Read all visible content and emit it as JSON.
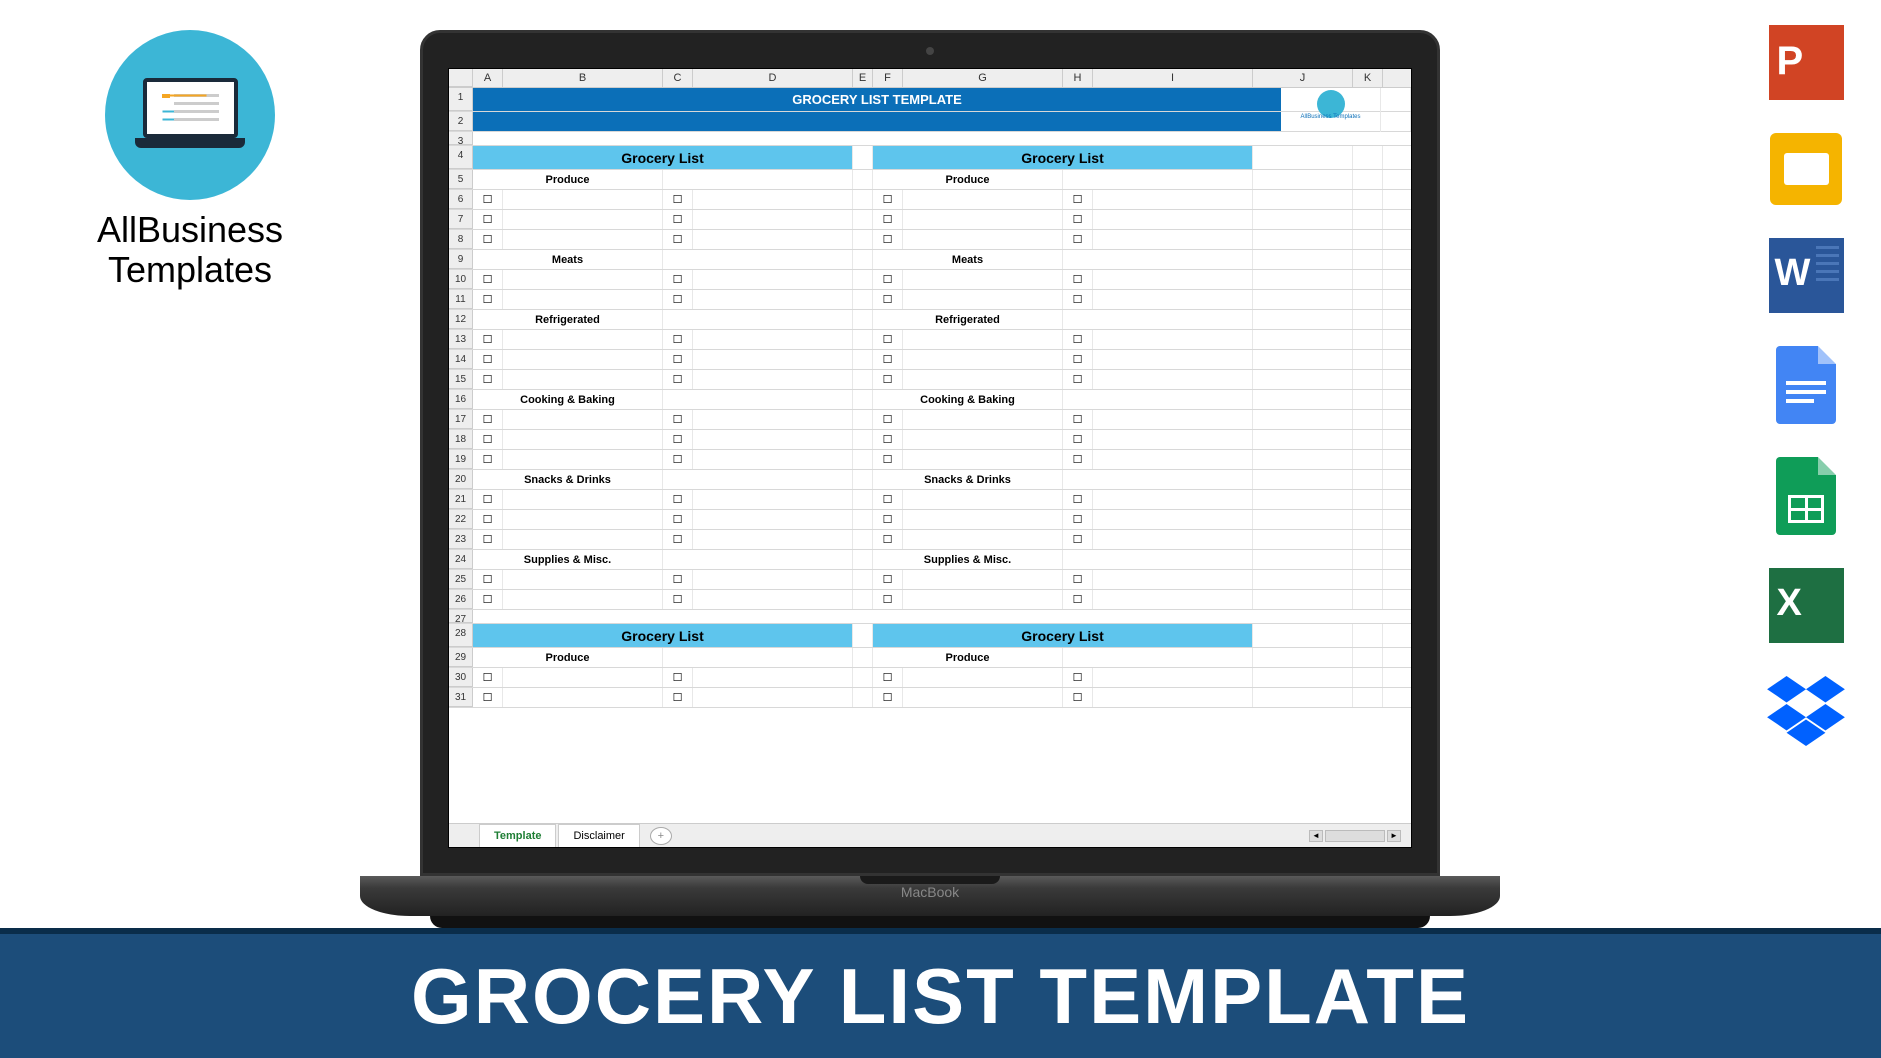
{
  "logo": {
    "line1": "AllBusiness",
    "line2": "Templates"
  },
  "banner": {
    "title": "GROCERY LIST TEMPLATE"
  },
  "icons": {
    "ppt": "PowerPoint",
    "slides": "Google Slides",
    "word": "Word",
    "docs": "Google Docs",
    "sheets": "Google Sheets",
    "excel": "Excel",
    "dropbox": "Dropbox"
  },
  "laptop_brand": "MacBook",
  "spreadsheet": {
    "columns": [
      "",
      "A",
      "B",
      "C",
      "D",
      "E",
      "F",
      "G",
      "H",
      "I",
      "J",
      "K"
    ],
    "row_numbers": [
      1,
      2,
      3,
      4,
      5,
      6,
      7,
      8,
      9,
      10,
      11,
      12,
      13,
      14,
      15,
      16,
      17,
      18,
      19,
      20,
      21,
      22,
      23,
      24,
      25,
      26,
      27,
      28,
      29,
      30,
      31
    ],
    "title": "GROCERY LIST TEMPLATE",
    "logo_badge": "AllBusiness Templates",
    "list_header": "Grocery List",
    "checkbox": "☐",
    "categories": {
      "produce": "Produce",
      "meats": "Meats",
      "refrigerated": "Refrigerated",
      "cooking": "Cooking & Baking",
      "snacks": "Snacks & Drinks",
      "supplies": "Supplies & Misc."
    },
    "sections": [
      {
        "cat": "Produce",
        "rows": 3
      },
      {
        "cat": "Meats",
        "rows": 2
      },
      {
        "cat": "Refrigerated",
        "rows": 3
      },
      {
        "cat": "Cooking & Baking",
        "rows": 3
      },
      {
        "cat": "Snacks & Drinks",
        "rows": 3
      },
      {
        "cat": "Supplies & Misc.",
        "rows": 2
      }
    ],
    "tabs": {
      "active": "Template",
      "inactive": "Disclaimer",
      "add": "+"
    }
  }
}
